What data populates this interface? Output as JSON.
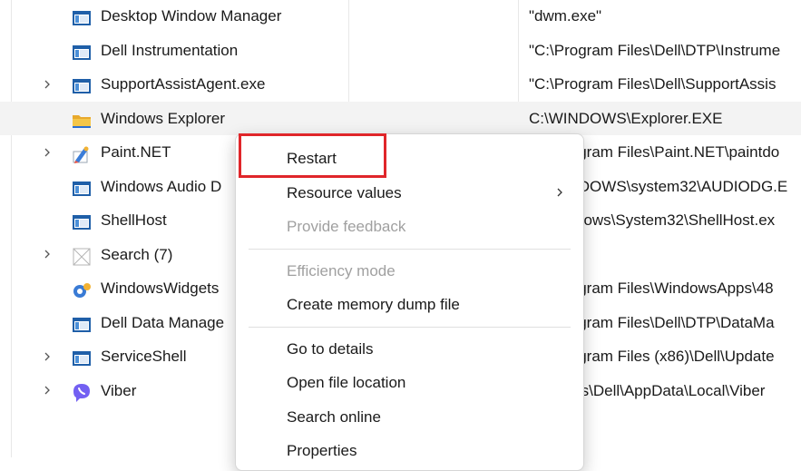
{
  "processes": [
    {
      "name": "Desktop Window Manager",
      "command": "\"dwm.exe\"",
      "expandable": false,
      "icon": "app-window-icon"
    },
    {
      "name": "Dell Instrumentation",
      "command": "\"C:\\Program Files\\Dell\\DTP\\Instrume",
      "expandable": false,
      "icon": "app-window-icon"
    },
    {
      "name": "SupportAssistAgent.exe",
      "command": "\"C:\\Program Files\\Dell\\SupportAssis",
      "expandable": true,
      "icon": "app-window-icon"
    },
    {
      "name": "Windows Explorer",
      "command": "C:\\WINDOWS\\Explorer.EXE",
      "expandable": false,
      "icon": "folder-icon",
      "hovered": true
    },
    {
      "name": "Paint.NET",
      "command": "\"C:\\Program Files\\Paint.NET\\paintdo",
      "expandable": true,
      "icon": "paint-net-icon"
    },
    {
      "name": "Windows Audio D",
      "command": "C:\\WINDOWS\\system32\\AUDIODG.E",
      "expandable": false,
      "icon": "app-window-icon"
    },
    {
      "name": "ShellHost",
      "command": "C:\\Windows\\System32\\ShellHost.ex",
      "expandable": false,
      "icon": "app-window-icon"
    },
    {
      "name": "Search (7)",
      "command": "",
      "expandable": true,
      "icon": "search-suspended-icon"
    },
    {
      "name": "WindowsWidgets",
      "command": "\"C:\\Program Files\\WindowsApps\\48",
      "expandable": false,
      "icon": "widgets-icon"
    },
    {
      "name": "Dell Data Manage",
      "command": "\"C:\\Program Files\\Dell\\DTP\\DataMa",
      "expandable": false,
      "icon": "app-window-icon"
    },
    {
      "name": "ServiceShell",
      "command": "\"C:\\Program Files (x86)\\Dell\\Update",
      "expandable": true,
      "icon": "app-window-icon"
    },
    {
      "name": "Viber",
      "command": "C:\\Users\\Dell\\AppData\\Local\\Viber",
      "expandable": true,
      "icon": "viber-icon"
    }
  ],
  "context_menu": {
    "items": [
      {
        "label": "Restart",
        "disabled": false,
        "submenu": false,
        "highlighted": true
      },
      {
        "label": "Resource values",
        "disabled": false,
        "submenu": true
      },
      {
        "label": "Provide feedback",
        "disabled": true,
        "submenu": false
      },
      {
        "separator": true
      },
      {
        "label": "Efficiency mode",
        "disabled": true,
        "submenu": false
      },
      {
        "label": "Create memory dump file",
        "disabled": false,
        "submenu": false
      },
      {
        "separator": true
      },
      {
        "label": "Go to details",
        "disabled": false,
        "submenu": false
      },
      {
        "label": "Open file location",
        "disabled": false,
        "submenu": false
      },
      {
        "label": "Search online",
        "disabled": false,
        "submenu": false
      },
      {
        "label": "Properties",
        "disabled": false,
        "submenu": false
      }
    ]
  },
  "colors": {
    "highlight_box": "#e0262a",
    "row_hover": "#f3f3f3",
    "disabled_text": "#a0a0a0"
  }
}
